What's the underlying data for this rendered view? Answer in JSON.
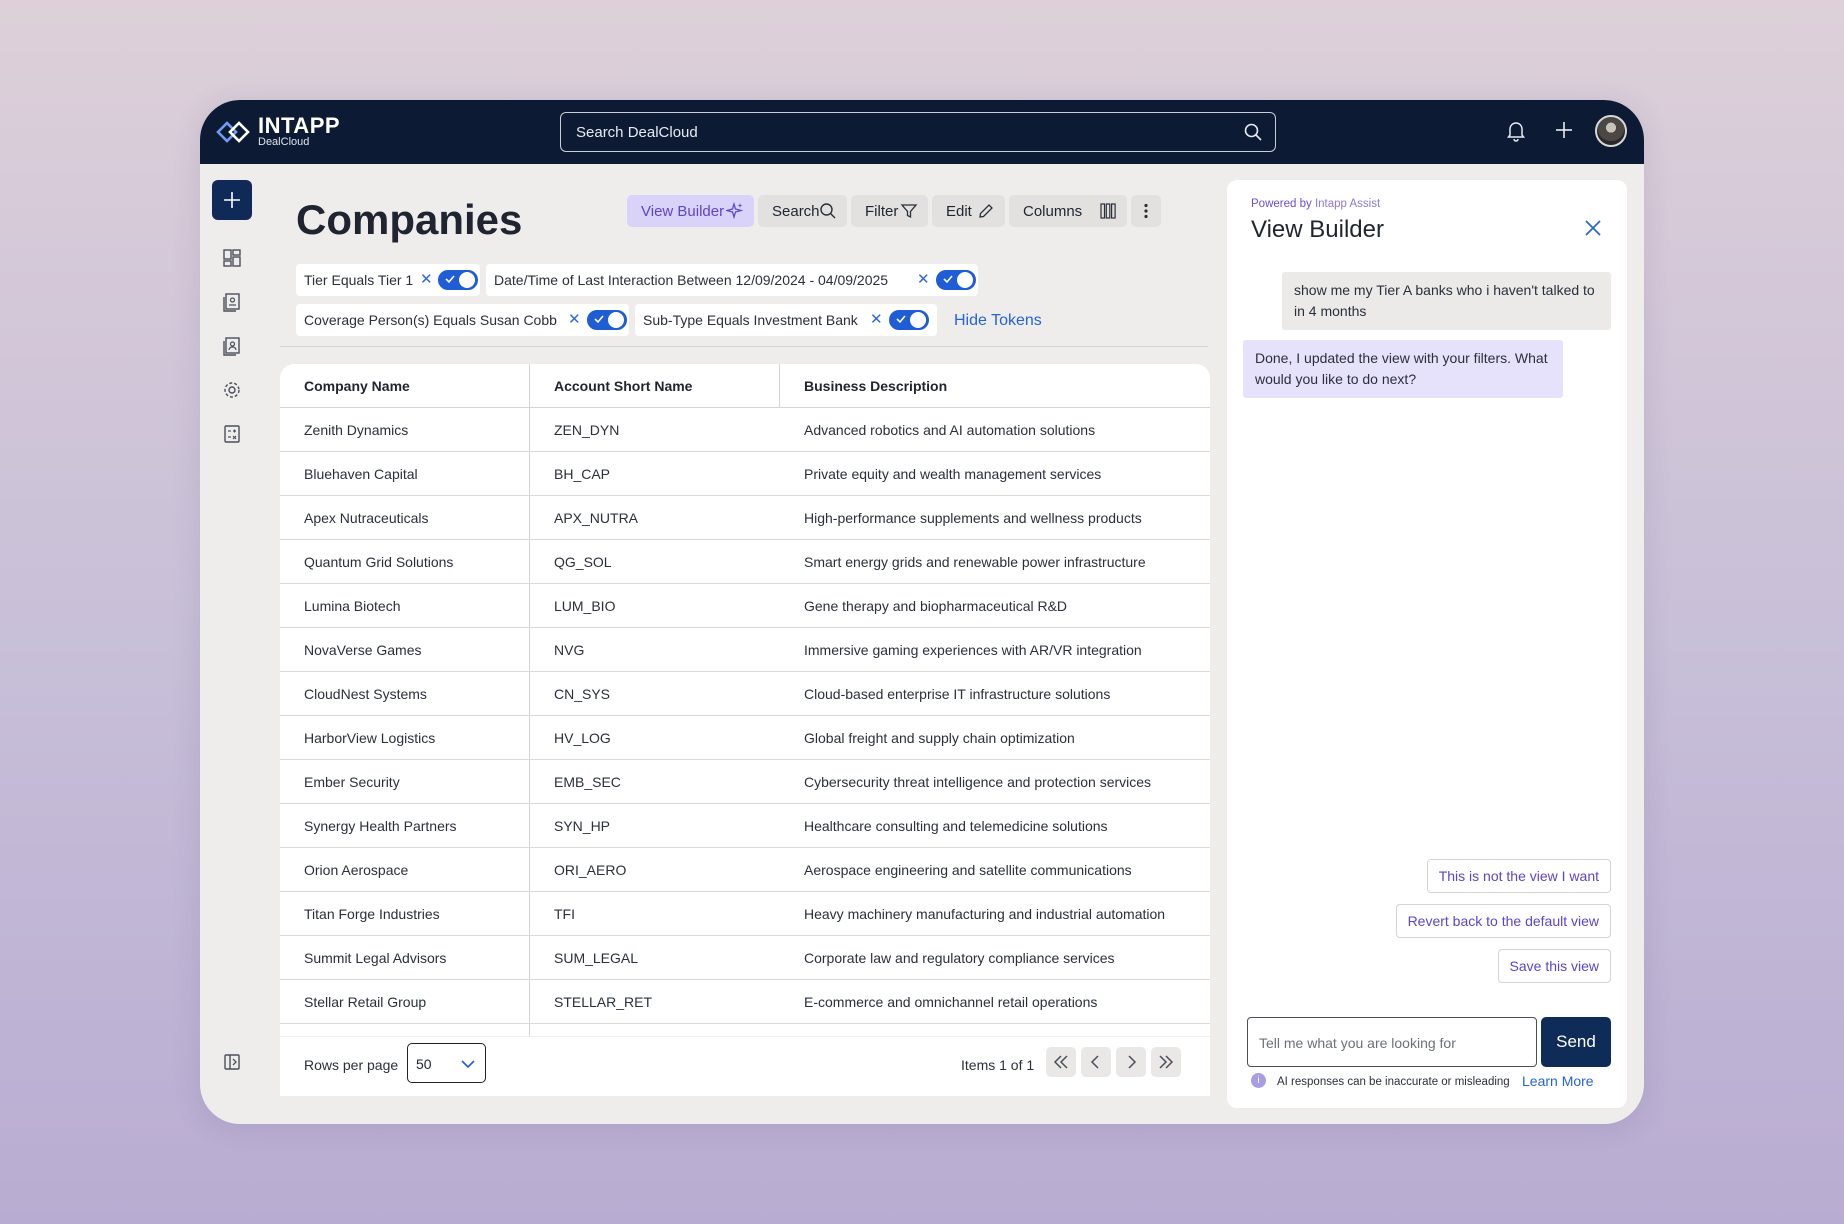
{
  "header": {
    "logo_main": "INTAPP",
    "logo_sub": "DealCloud",
    "search_placeholder": "Search DealCloud"
  },
  "page": {
    "title": "Companies"
  },
  "toolbar": {
    "view_builder": "View Builder",
    "search": "Search",
    "filter": "Filter",
    "edit": "Edit",
    "columns": "Columns"
  },
  "tokens": [
    {
      "label": "Tier Equals Tier 1",
      "enabled": true
    },
    {
      "label": "Date/Time of Last Interaction Between 12/09/2024 - 04/09/2025",
      "enabled": true
    },
    {
      "label": "Coverage Person(s) Equals Susan Cobb",
      "enabled": true
    },
    {
      "label": "Sub-Type Equals Investment Bank",
      "enabled": true
    }
  ],
  "hide_tokens": "Hide Tokens",
  "table": {
    "columns": [
      "Company Name",
      "Account Short Name",
      "Business Description"
    ],
    "rows": [
      [
        "Zenith Dynamics",
        "ZEN_DYN",
        "Advanced robotics and AI automation solutions"
      ],
      [
        "Bluehaven Capital",
        "BH_CAP",
        "Private equity and wealth management services"
      ],
      [
        "Apex Nutraceuticals",
        "APX_NUTRA",
        "High-performance supplements and wellness products"
      ],
      [
        "Quantum Grid Solutions",
        "QG_SOL",
        "Smart energy grids and renewable power infrastructure"
      ],
      [
        "Lumina Biotech",
        "LUM_BIO",
        "Gene therapy and biopharmaceutical R&D"
      ],
      [
        "NovaVerse Games",
        "NVG",
        "Immersive gaming experiences with AR/VR integration"
      ],
      [
        "CloudNest Systems",
        "CN_SYS",
        "Cloud-based enterprise IT infrastructure solutions"
      ],
      [
        "HarborView Logistics",
        "HV_LOG",
        "Global freight and supply chain optimization"
      ],
      [
        "Ember Security",
        "EMB_SEC",
        "Cybersecurity threat intelligence and protection services"
      ],
      [
        "Synergy Health Partners",
        "SYN_HP",
        "Healthcare consulting and telemedicine solutions"
      ],
      [
        "Orion Aerospace",
        "ORI_AERO",
        "Aerospace engineering and satellite communications"
      ],
      [
        "Titan Forge Industries",
        "TFI",
        "Heavy machinery manufacturing and industrial automation"
      ],
      [
        "Summit Legal Advisors",
        "SUM_LEGAL",
        "Corporate law and regulatory compliance services"
      ],
      [
        "Stellar Retail Group",
        "STELLAR_RET",
        "E-commerce and omnichannel retail operations"
      ]
    ]
  },
  "pagination": {
    "rows_per_page_label": "Rows per page",
    "rows_per_page_value": "50",
    "items_label": "Items 1 of 1"
  },
  "view_builder": {
    "powered_prefix": "Powered by ",
    "powered_brand": "Intapp Assist",
    "title": "View Builder",
    "messages": [
      {
        "role": "user",
        "text": "show me my Tier A banks who i haven't talked to in 4 months"
      },
      {
        "role": "assistant",
        "text": "Done, I updated the view with your filters. What would you like to do next?"
      }
    ],
    "suggestions": [
      "This is not the view I want",
      "Revert back to the default view",
      "Save this view"
    ],
    "input_placeholder": "Tell me what you are looking for",
    "send_label": "Send",
    "disclaimer": "AI responses can be inaccurate or misleading",
    "learn_more": "Learn More"
  },
  "colors": {
    "navy": "#0d1a33",
    "accent_blue": "#1f5dd6",
    "purple": "#5a47c7",
    "view_builder_bg": "#d9d3fa"
  }
}
